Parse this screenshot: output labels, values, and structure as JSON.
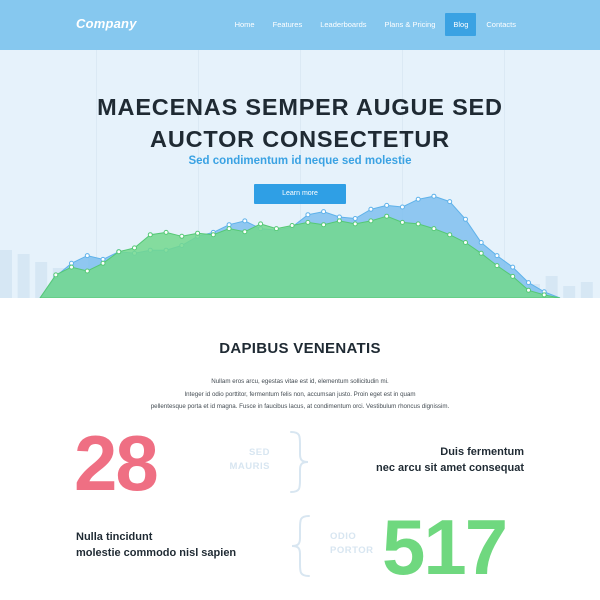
{
  "navbar": {
    "logo": "Company",
    "items": [
      {
        "label": "Home"
      },
      {
        "label": "Features"
      },
      {
        "label": "Leaderboards"
      },
      {
        "label": "Plans & Pricing"
      },
      {
        "label": "Blog"
      },
      {
        "label": "Contacts"
      }
    ],
    "active_item": "Blog"
  },
  "hero": {
    "title_line1": "MAECENAS SEMPER AUGUE SED",
    "title_line2": "AUCTOR CONSECTETUR",
    "subtitle": "Sed condimentum id neque sed molestie",
    "button_label": "Learn more"
  },
  "section": {
    "title": "DAPIBUS VENENATIS",
    "text_lines": [
      "Nullam eros arcu, egestas vitae est id, elementum sollicitudin mi.",
      "Integer id odio porttitor, fermentum felis non, accumsan justo. Proin eget est in quam",
      "pellentesque porta et id magna. Fusce in faucibus lacus, at condimentum orci. Vestibulum rhoncus dignissim."
    ]
  },
  "stats": [
    {
      "number": "28",
      "tag_line1": "SED",
      "tag_line2": "MAURIS",
      "desc_line1": "Duis fermentum",
      "desc_line2": "nec arcu sit amet consequat",
      "color": "#ef6f83"
    },
    {
      "number": "517",
      "tag_line1": "ODIO",
      "tag_line2": "PORTOR",
      "desc_line1": "Nulla tincidunt",
      "desc_line2": "molestie commodo nisl sapien",
      "color": "#6fd87f"
    }
  ],
  "colors": {
    "nav_bg": "#86c8ef",
    "accent_blue": "#3aa2e3",
    "hero_bg": "#e6f2fb",
    "green_series": "#72d88d",
    "blue_series": "#7fc0ee"
  },
  "chart_data": {
    "type": "area",
    "series": [
      {
        "values": [
          0,
          28,
          45,
          55,
          50,
          60,
          58,
          62,
          62,
          68,
          80,
          85,
          95,
          100,
          90,
          88,
          92,
          108,
          112,
          105,
          103,
          115,
          120,
          118,
          128,
          132,
          125,
          102,
          72,
          55,
          40,
          20,
          8,
          0
        ]
      },
      {
        "values": [
          0,
          30,
          40,
          35,
          45,
          60,
          65,
          82,
          85,
          80,
          84,
          82,
          90,
          86,
          96,
          90,
          94,
          98,
          95,
          100,
          96,
          100,
          106,
          98,
          96,
          90,
          82,
          72,
          58,
          42,
          28,
          10,
          4,
          0
        ]
      }
    ]
  }
}
